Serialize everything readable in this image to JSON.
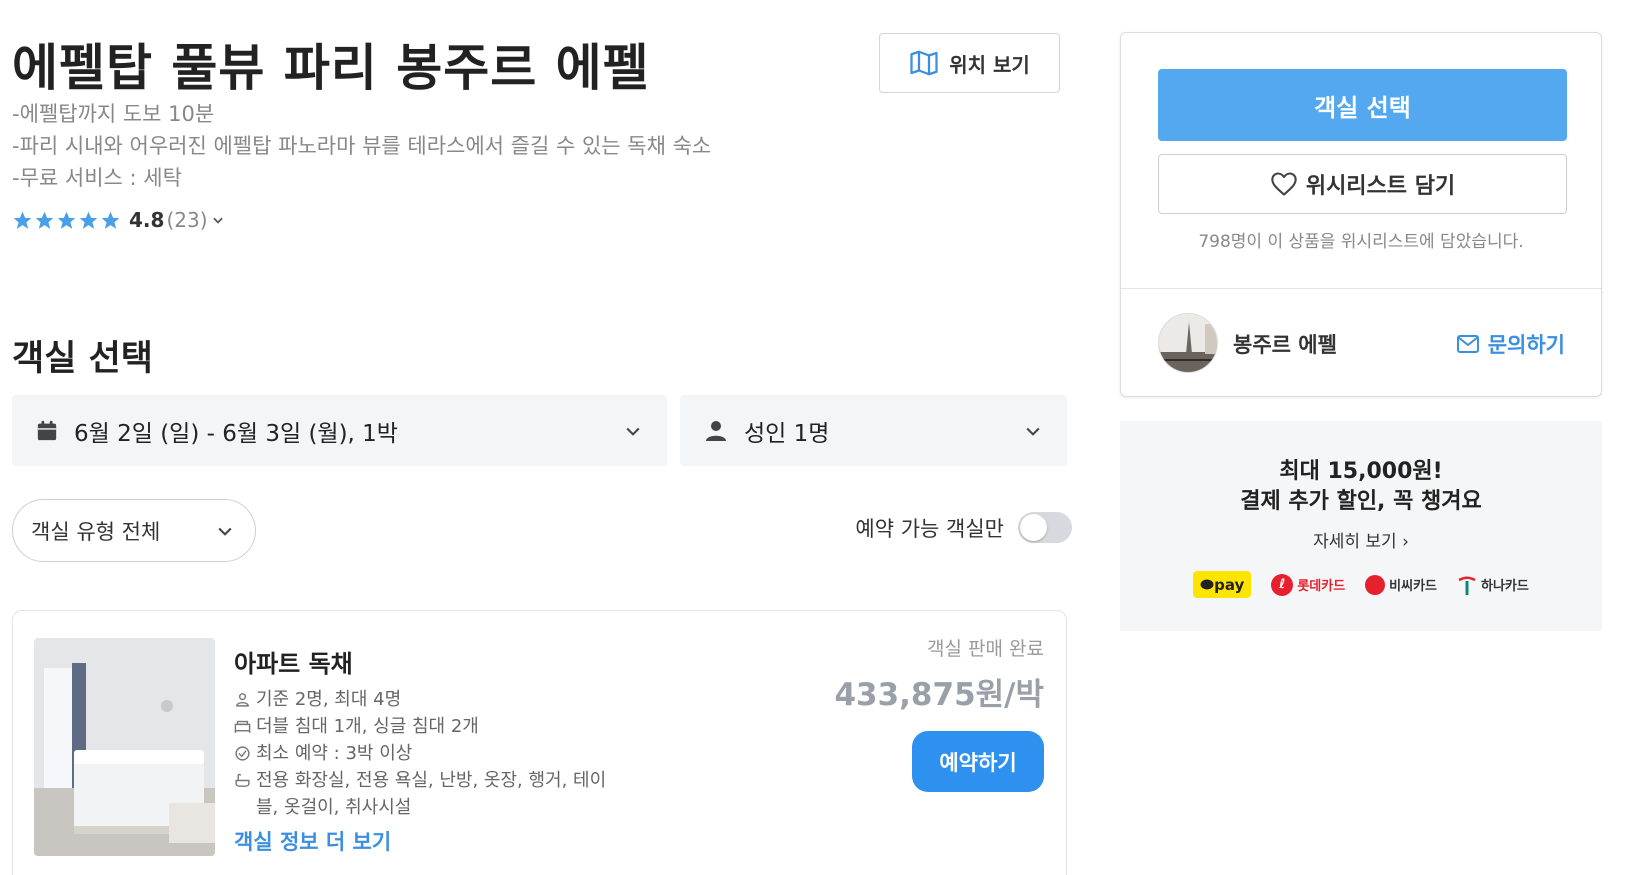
{
  "header": {
    "title": "에펠탑 풀뷰 파리 봉주르 에펠",
    "map_button": "위치 보기",
    "desc": [
      "-에펠탑까지 도보 10분",
      "-파리 시내와 어우러진 에펠탑 파노라마 뷰를 테라스에서 즐길 수 있는 독채 숙소",
      "-무료 서비스 : 세탁"
    ],
    "rating": {
      "score": "4.8",
      "count": "(23)",
      "stars": 5,
      "color": "#4a9fe8"
    }
  },
  "room_select": {
    "section_title": "객실 선택",
    "date": "6월 2일 (일) - 6월 3일 (월), 1박",
    "guests": "성인 1명",
    "room_type_filter": "객실 유형 전체",
    "available_only_label": "예약 가능 객실만",
    "available_only_on": false
  },
  "rooms": [
    {
      "name": "아파트 독채",
      "amenities": [
        "기준 2명, 최대 4명",
        "더블 침대 1개, 싱글 침대 2개",
        "최소 예약 : 3박 이상",
        "전용 화장실, 전용 욕실, 난방, 옷장, 행거, 테이",
        "블, 옷걸이, 취사시설"
      ],
      "more_link": "객실 정보 더 보기",
      "status": "객실 판매 완료",
      "price": "433,875원/박",
      "book_button": "예약하기"
    }
  ],
  "sidebar": {
    "select_button": "객실 선택",
    "wishlist_button": "위시리스트 담기",
    "wishlist_count": "798명이 이 상품을 위시리스트에 담았습니다.",
    "host_name": "봉주르 에펠",
    "contact_link": "문의하기"
  },
  "promo": {
    "line1": "최대 15,000원!",
    "line2": "결제 추가 할인, 꼭 챙겨요",
    "detail_link": "자세히 보기 ›",
    "logos": {
      "kakaopay": "pay",
      "lotte": "롯데카드",
      "bc": "비씨카드",
      "hana": "하나카드"
    }
  },
  "colors": {
    "accent": "#53a8f0",
    "book_button": "#2e91ef",
    "link": "#3b8fe0",
    "price_disabled": "#9aa0a8"
  }
}
